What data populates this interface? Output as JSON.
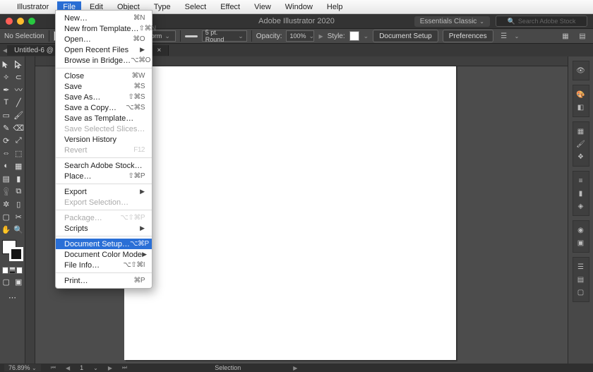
{
  "mac_menu": {
    "app_name": "Illustrator",
    "items": [
      "File",
      "Edit",
      "Object",
      "Type",
      "Select",
      "Effect",
      "View",
      "Window",
      "Help"
    ],
    "active_index": 0
  },
  "titlebar": {
    "app_title": "Adobe Illustrator 2020",
    "workspace_label": "Essentials Classic",
    "search_placeholder": "Search Adobe Stock"
  },
  "control": {
    "selection_label": "No Selection",
    "stroke_weight": "",
    "uniform_label": "Uniform",
    "profile_label": "5 pt. Round",
    "opacity_label": "Opacity:",
    "opacity_value": "100%",
    "style_label": "Style:",
    "doc_setup": "Document Setup",
    "preferences": "Preferences"
  },
  "tab": {
    "name": "Untitled-6 @ 76.89% (CMYK/GPU Preview)"
  },
  "file_menu": [
    {
      "label": "New…",
      "shortcut": "⌘N"
    },
    {
      "label": "New from Template…",
      "shortcut": "⇧⌘N"
    },
    {
      "label": "Open…",
      "shortcut": "⌘O"
    },
    {
      "label": "Open Recent Files",
      "submenu": true
    },
    {
      "label": "Browse in Bridge…",
      "shortcut": "⌥⌘O"
    },
    {
      "sep": true
    },
    {
      "label": "Close",
      "shortcut": "⌘W"
    },
    {
      "label": "Save",
      "shortcut": "⌘S"
    },
    {
      "label": "Save As…",
      "shortcut": "⇧⌘S"
    },
    {
      "label": "Save a Copy…",
      "shortcut": "⌥⌘S"
    },
    {
      "label": "Save as Template…"
    },
    {
      "label": "Save Selected Slices…",
      "disabled": true
    },
    {
      "label": "Version History"
    },
    {
      "label": "Revert",
      "shortcut": "F12",
      "disabled": true
    },
    {
      "sep": true
    },
    {
      "label": "Search Adobe Stock…"
    },
    {
      "label": "Place…",
      "shortcut": "⇧⌘P"
    },
    {
      "sep": true
    },
    {
      "label": "Export",
      "submenu": true
    },
    {
      "label": "Export Selection…",
      "disabled": true
    },
    {
      "sep": true
    },
    {
      "label": "Package…",
      "shortcut": "⌥⇧⌘P",
      "disabled": true
    },
    {
      "label": "Scripts",
      "submenu": true
    },
    {
      "sep": true
    },
    {
      "label": "Document Setup…",
      "shortcut": "⌥⌘P",
      "highlight": true
    },
    {
      "label": "Document Color Mode",
      "submenu": true
    },
    {
      "label": "File Info…",
      "shortcut": "⌥⇧⌘I"
    },
    {
      "sep": true
    },
    {
      "label": "Print…",
      "shortcut": "⌘P"
    }
  ],
  "status": {
    "zoom": "76.89%",
    "nav1": "1",
    "nav2": "1",
    "mode": "Selection"
  }
}
